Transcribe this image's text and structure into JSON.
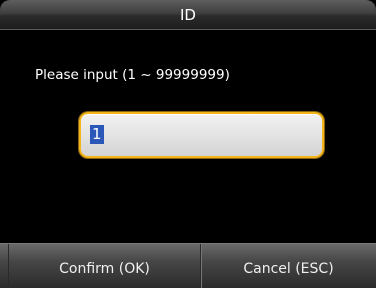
{
  "window": {
    "title": "ID"
  },
  "prompt": {
    "text": "Please input (1 ~ 99999999)"
  },
  "input": {
    "value": "1"
  },
  "buttons": {
    "confirm_label": "Confirm (OK)",
    "cancel_label": "Cancel (ESC)"
  },
  "colors": {
    "background": "#000000",
    "input_border": "#f3b51a",
    "selection": "#2b57b8",
    "text": "#ffffff"
  }
}
